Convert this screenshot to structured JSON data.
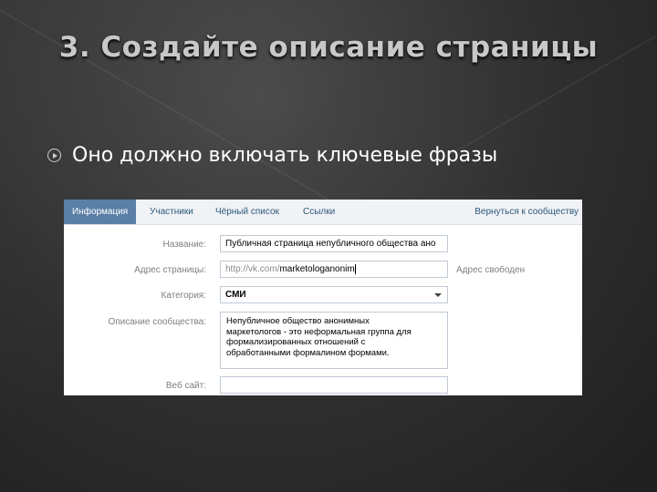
{
  "slide": {
    "title": "3. Создайте описание страницы",
    "bullet": "Оно должно включать ключевые фразы"
  },
  "screenshot": {
    "tabs": [
      "Информация",
      "Участники",
      "Чёрный список",
      "Ссылки"
    ],
    "back_link": "Вернуться к сообществу",
    "fields": {
      "name_label": "Название:",
      "name_value": "Публичная страница непубличного общества ано",
      "address_label": "Адрес страницы:",
      "address_prefix": "http://vk.com/",
      "address_value": "marketologanonim",
      "address_hint": "Адрес свободен",
      "category_label": "Категория:",
      "category_value": "СМИ",
      "description_label": "Описание сообщества:",
      "description_lines": [
        "Непубличное общество анонимных",
        "маркетологов - это неформальная группа для",
        "формализированных отношений с",
        "обработанными формалином формами."
      ],
      "website_label": "Веб сайт:",
      "website_value": ""
    }
  },
  "colors": {
    "accent": "#5b7fa6",
    "link": "#2b587a"
  }
}
